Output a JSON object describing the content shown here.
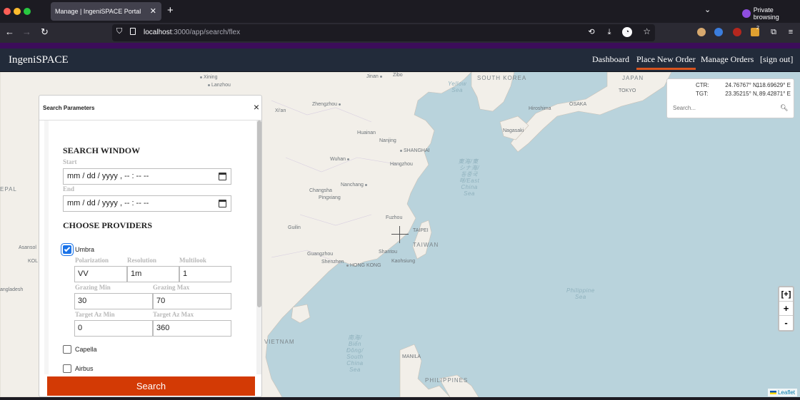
{
  "browser": {
    "tab_title": "Manage | IngeniSPACE Portal",
    "url_host": "localhost",
    "url_path": ":3000/app/search/flex",
    "private_label": "Private browsing",
    "extension_badge": "2"
  },
  "app": {
    "brand": "IngeniSPACE",
    "nav": [
      {
        "label": "Dashboard",
        "active": false
      },
      {
        "label": "Place New Order",
        "active": true
      },
      {
        "label": "Manage Orders",
        "active": false
      },
      {
        "label": "[sign out]",
        "active": false
      }
    ]
  },
  "coords": {
    "ctr_label": "CTR:",
    "ctr_lat": "24.76767° N,",
    "ctr_lon": "118.69629° E",
    "tgt_label": "TGT:",
    "tgt_lat": "23.35215° N,",
    "tgt_lon": "89.42871° E",
    "search_placeholder": "Search..."
  },
  "map": {
    "zoom_expand": "[+]",
    "zoom_in": "+",
    "zoom_out": "-",
    "attribution": "Leaflet",
    "labels": [
      {
        "text": "Lanzhou",
        "cls": "city"
      },
      {
        "text": "Xining",
        "cls": "city"
      },
      {
        "text": "Jinan",
        "cls": "city"
      },
      {
        "text": "Zibo",
        "cls": "city"
      },
      {
        "text": "Zhengzhou",
        "cls": "city"
      },
      {
        "text": "Xi'an",
        "cls": "city"
      },
      {
        "text": "Huainan",
        "cls": "city"
      },
      {
        "text": "Nanjing",
        "cls": "city"
      },
      {
        "text": "SHANGHAI",
        "cls": "city"
      },
      {
        "text": "Wuhan",
        "cls": "city"
      },
      {
        "text": "Hangzhou",
        "cls": "city"
      },
      {
        "text": "Nanchang",
        "cls": "city"
      },
      {
        "text": "Changsha",
        "cls": "city"
      },
      {
        "text": "Pingxiang",
        "cls": "city"
      },
      {
        "text": "Fuzhou",
        "cls": "city"
      },
      {
        "text": "Guilin",
        "cls": "city"
      },
      {
        "text": "TAIPEI",
        "cls": "city"
      },
      {
        "text": "Guangzhou",
        "cls": "city"
      },
      {
        "text": "Shantou",
        "cls": "city"
      },
      {
        "text": "Shenzhen",
        "cls": "city"
      },
      {
        "text": "HONG KONG",
        "cls": "city"
      },
      {
        "text": "Kaohsiung",
        "cls": "city"
      },
      {
        "text": "Asansol",
        "cls": "city"
      },
      {
        "text": "KOL",
        "cls": "city"
      },
      {
        "text": "angladesh",
        "cls": "city"
      },
      {
        "text": "EPAL",
        "cls": "country"
      },
      {
        "text": "SOUTH KOREA",
        "cls": "country"
      },
      {
        "text": "JAPAN",
        "cls": "country"
      },
      {
        "text": "TOKYO",
        "cls": "city"
      },
      {
        "text": "OSAKA",
        "cls": "city"
      },
      {
        "text": "Hiroshima",
        "cls": "city"
      },
      {
        "text": "Nagasaki",
        "cls": "city"
      },
      {
        "text": "TAIWAN",
        "cls": "country"
      },
      {
        "text": "VIETNAM",
        "cls": "country"
      },
      {
        "text": "MANILA",
        "cls": "city"
      },
      {
        "text": "PHILIPPINES",
        "cls": "country"
      }
    ],
    "seas": [
      {
        "text": "Yellow\nSea"
      },
      {
        "text": "東海/東\n シナ海/\n 동중국\n 해/East\n China\n Sea"
      },
      {
        "text": "Philippine\nSea"
      },
      {
        "text": "南海/\nBiển\nĐông/\nSouth\nChina\nSea"
      }
    ]
  },
  "panel": {
    "title": "Search Parameters",
    "close": "×",
    "search_window_title": "SEARCH WINDOW",
    "start_label": "Start",
    "start_value": "mm / dd / yyyy ,  -- : --   --",
    "end_label": "End",
    "end_value": "mm / dd / yyyy ,  -- : --   --",
    "providers_title": "CHOOSE PROVIDERS",
    "providers": [
      {
        "name": "Umbra",
        "checked": true
      },
      {
        "name": "Capella",
        "checked": false
      },
      {
        "name": "Airbus",
        "checked": false
      }
    ],
    "umbra": {
      "polarization_label": "Polarization",
      "polarization": "VV",
      "resolution_label": "Resolution",
      "resolution": "1m",
      "multilook_label": "Multilook",
      "multilook": "1",
      "grazing_min_label": "Grazing Min",
      "grazing_min": "30",
      "grazing_max_label": "Grazing Max",
      "grazing_max": "70",
      "target_az_min_label": "Target Az Min",
      "target_az_min": "0",
      "target_az_max_label": "Target Az Max",
      "target_az_max": "360"
    },
    "search_button": "Search"
  }
}
